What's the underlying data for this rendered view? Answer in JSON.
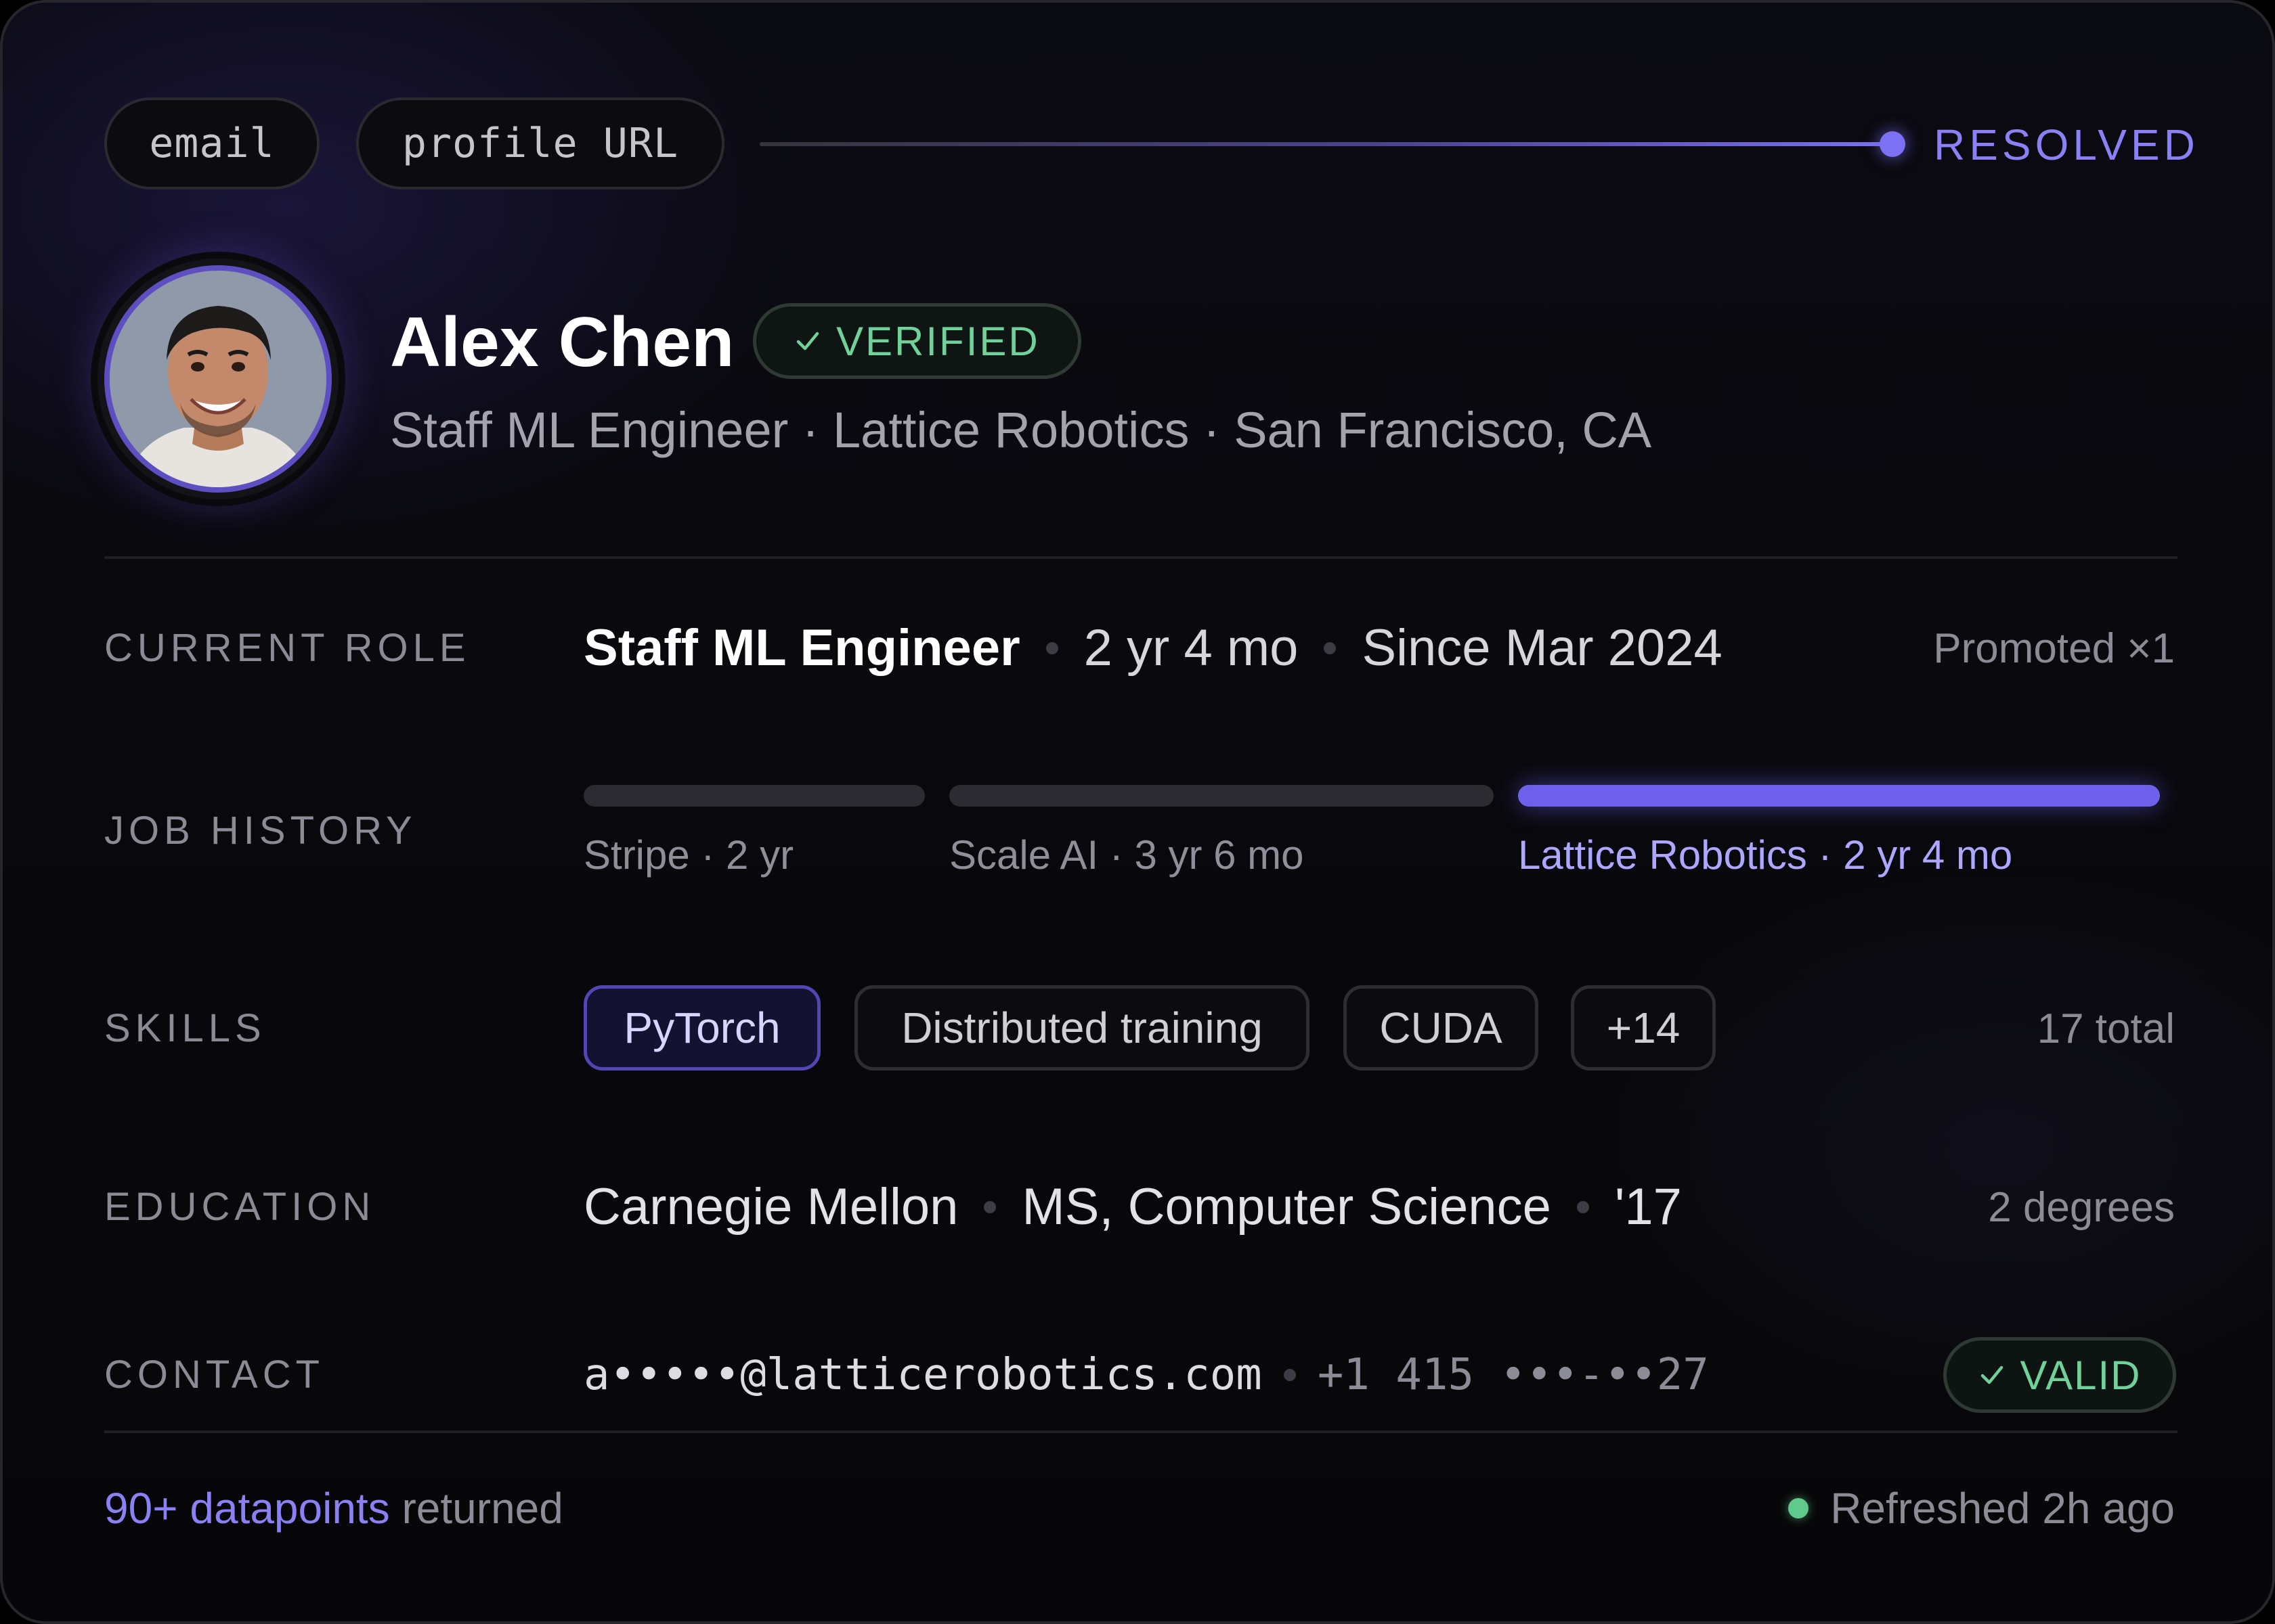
{
  "lookup": {
    "inputs": [
      "email",
      "profile URL"
    ],
    "status": "RESOLVED"
  },
  "profile": {
    "name": "Alex Chen",
    "verified_label": "VERIFIED",
    "subtitle": "Staff ML Engineer · Lattice Robotics · San Francisco, CA"
  },
  "current_role": {
    "label": "CURRENT ROLE",
    "title": "Staff ML Engineer",
    "tenure": "2 yr 4 mo",
    "since": "Since Mar 2024",
    "meta": "Promoted ×1"
  },
  "job_history": {
    "label": "JOB HISTORY",
    "jobs": [
      {
        "label": "Stripe · 2 yr",
        "active": false
      },
      {
        "label": "Scale AI · 3 yr 6 mo",
        "active": false
      },
      {
        "label": "Lattice Robotics · 2 yr 4 mo",
        "active": true
      }
    ]
  },
  "skills": {
    "label": "SKILLS",
    "chips": [
      "PyTorch",
      "Distributed training",
      "CUDA",
      "+14"
    ],
    "meta": "17 total"
  },
  "education": {
    "label": "EDUCATION",
    "school": "Carnegie Mellon",
    "degree": "MS, Computer Science",
    "year": "'17",
    "meta": "2 degrees"
  },
  "contact": {
    "label": "CONTACT",
    "email": "a•••••@latticerobotics.com",
    "phone": "+1 415 •••-••27",
    "valid_label": "VALID"
  },
  "footer": {
    "datapoints": "90+ datapoints",
    "returned": " returned",
    "refreshed": "Refreshed 2h ago"
  },
  "colors": {
    "accent": "#7c70f4",
    "success": "#6fd29a",
    "background": "#08080b"
  }
}
